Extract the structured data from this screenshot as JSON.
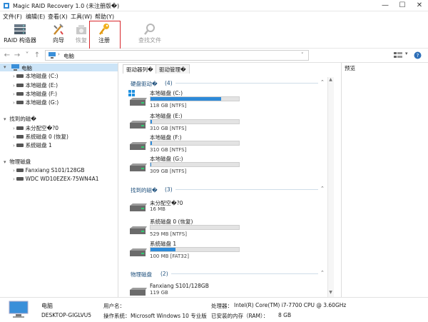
{
  "window": {
    "title": "Magic RAID Recovery 1.0 (未注册版�)",
    "controls": [
      "—",
      "☐",
      "✕"
    ]
  },
  "menu": [
    "文件(F)",
    "编辑(E)",
    "查看(X)",
    "工具(W)",
    "帮助(Y)"
  ],
  "toolbar": {
    "raid": "RAID 构造器",
    "wizard": "向导",
    "recover": "恢复",
    "register": "注册",
    "search": "查找文件"
  },
  "address": {
    "path": "电脑",
    "nav": [
      "←",
      "→",
      "˅",
      "↑"
    ]
  },
  "tree": {
    "root": "电脑",
    "local": [
      "本地磁盘 (C:)",
      "本地磁盘 (E:)",
      "本地磁盘 (F:)",
      "本地磁盘 (G:)"
    ],
    "found_title": "找到的磁�",
    "found": [
      "未分配空�?0",
      "系统磁盘 0 (恢复)",
      "系统磁盘 1"
    ],
    "phys_title": "物理磁盘",
    "phys": [
      "Fanxiang S101/128GB",
      "WDC WD10EZEX-75WN4A1"
    ]
  },
  "tabs": [
    "驱动器列�",
    "驱动管理�"
  ],
  "preview": "预览",
  "sections": {
    "hdd": {
      "title": "硬盘驱动�",
      "count": "(4)"
    },
    "found": {
      "title": "找到的磁�",
      "count": "(3)"
    },
    "phys": {
      "title": "物理磁盘",
      "count": "(2)"
    }
  },
  "drives": [
    {
      "name": "本地磁盘 (C:)",
      "info": "118 GB [NTFS]",
      "fill": 0.8,
      "win": true
    },
    {
      "name": "本地磁盘 (E:)",
      "info": "310 GB [NTFS]",
      "fill": 0.02,
      "win": false
    },
    {
      "name": "本地磁盘 (F:)",
      "info": "310 GB [NTFS]",
      "fill": 0.02,
      "win": false
    },
    {
      "name": "本地磁盘 (G:)",
      "info": "309 GB [NTFS]",
      "fill": 0.01,
      "win": false
    }
  ],
  "found_drives": [
    {
      "name": "未分配空�?0",
      "info": "16 MB",
      "fill": null
    },
    {
      "name": "系统磁盘 0 (恢复)",
      "info": "529 MB [NTFS]",
      "fill": 0.0
    },
    {
      "name": "系统磁盘 1",
      "info": "100 MB [FAT32]",
      "fill": 0.28
    }
  ],
  "phys_drives": [
    {
      "name": "Fanxiang S101/128GB",
      "info": "119 GB"
    }
  ],
  "status": {
    "name": "电脑",
    "host": "DESKTOP-GIGLVU5",
    "user_label": "用户名：",
    "user_val": "",
    "os_label": "操作系统：",
    "os_val": "Microsoft Windows 10 专业版",
    "cpu_label": "处理器：",
    "cpu_val": "Intel(R) Core(TM) i7-7700 CPU @ 3.60GHz",
    "ram_label": "已安装的内存（RAM）：",
    "ram_val": "8 GB"
  },
  "colors": {
    "accent": "#2e8ad8",
    "highlight": "#d8262b",
    "selection": "#cce4f7"
  }
}
